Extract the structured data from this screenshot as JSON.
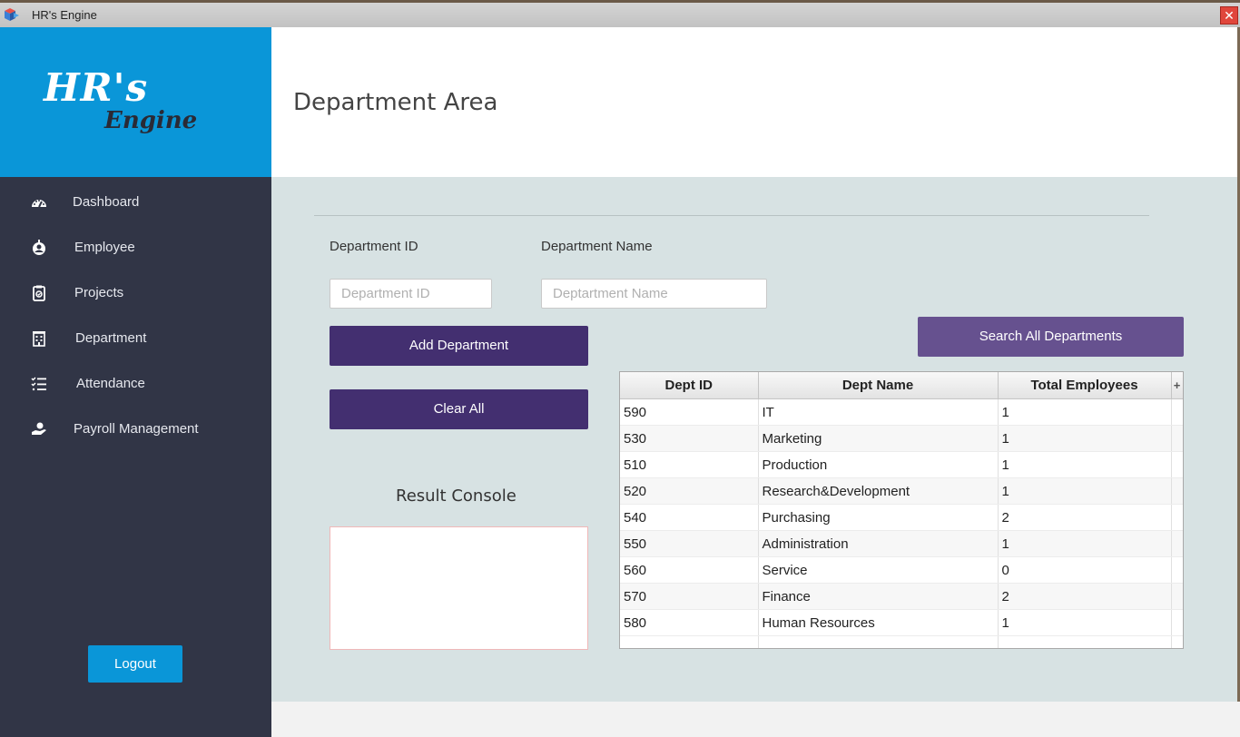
{
  "window": {
    "title": "HR's Engine",
    "close_glyph": "✕"
  },
  "logo": {
    "line1": "HR's",
    "line2": "Engine"
  },
  "sidebar": {
    "items": [
      {
        "label": "Dashboard",
        "icon": "dashboard-gauge-icon"
      },
      {
        "label": "Employee",
        "icon": "employee-icon"
      },
      {
        "label": "Projects",
        "icon": "clipboard-icon"
      },
      {
        "label": "Department",
        "icon": "building-icon"
      },
      {
        "label": "Attendance",
        "icon": "checklist-icon"
      },
      {
        "label": "Payroll Management",
        "icon": "hand-coin-icon"
      }
    ],
    "logout_label": "Logout"
  },
  "header": {
    "title": "Department Area"
  },
  "form": {
    "dept_id_label": "Department  ID",
    "dept_name_label": "Department Name",
    "dept_id_placeholder": "Department ID",
    "dept_name_placeholder": "Deptartment Name",
    "add_button": "Add Department",
    "clear_button": "Clear All",
    "search_button": "Search All Departments",
    "console_label": "Result Console"
  },
  "table": {
    "columns": [
      "Dept ID",
      "Dept Name",
      "Total Employees",
      "+"
    ],
    "rows": [
      [
        "590",
        "IT",
        "1"
      ],
      [
        "530",
        "Marketing",
        "1"
      ],
      [
        "510",
        "Production",
        "1"
      ],
      [
        "520",
        "Research&Development",
        "1"
      ],
      [
        "540",
        "Purchasing",
        "2"
      ],
      [
        "550",
        "Administration",
        "1"
      ],
      [
        "560",
        "Service",
        "0"
      ],
      [
        "570",
        "Finance",
        "2"
      ],
      [
        "580",
        "Human Resources",
        "1"
      ]
    ]
  },
  "colors": {
    "sidebar_bg": "#313546",
    "brand_blue": "#0a96d8",
    "button_purple": "#432f70",
    "search_purple": "#66518f",
    "content_bg": "#d7e2e3"
  }
}
